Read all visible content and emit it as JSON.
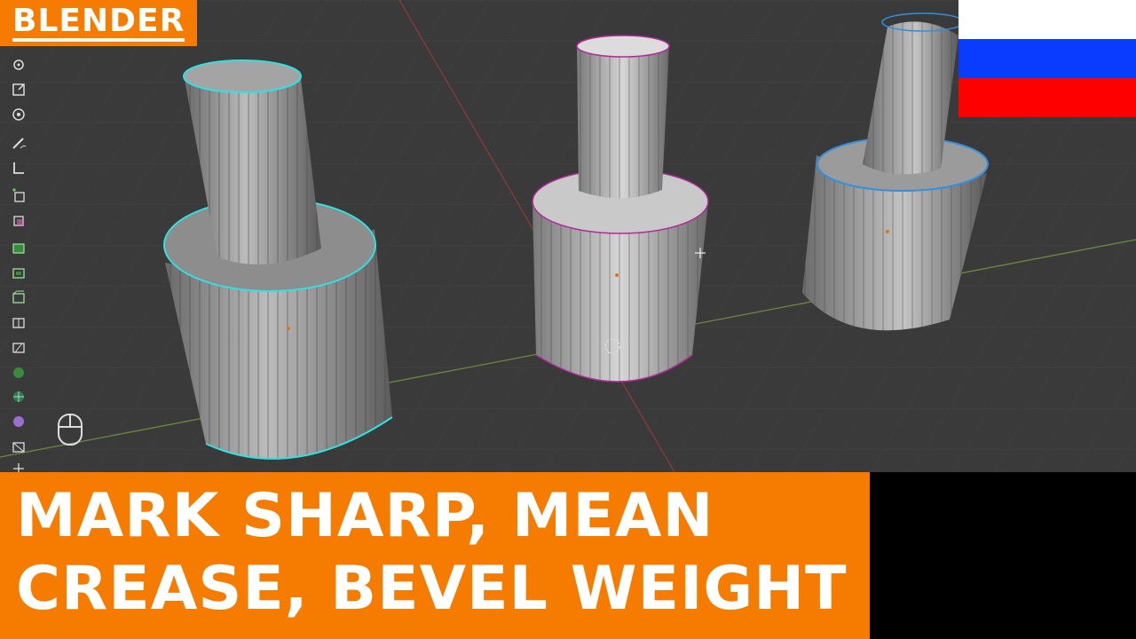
{
  "app": {
    "badge_label": "BLENDER"
  },
  "title": {
    "line1": "MARK SHARP, MEAN",
    "line2": "CREASE, BEVEL WEIGHT"
  },
  "flag": {
    "colors": [
      "#ffffff",
      "#0a3cff",
      "#ff0000"
    ]
  },
  "theme": {
    "accent": "#f57c00",
    "viewport_bg": "#3a3a3a"
  },
  "toolbar": {
    "tools": [
      {
        "name": "transform-icon"
      },
      {
        "name": "scale-icon"
      },
      {
        "name": "rotate-icon"
      },
      {
        "name": "annotate-icon"
      },
      {
        "name": "measure-icon"
      },
      {
        "name": "add-cube-icon"
      },
      {
        "name": "extrude-icon"
      },
      {
        "name": "inset-icon"
      },
      {
        "name": "bevel-icon"
      },
      {
        "name": "loop-cut-icon"
      },
      {
        "name": "knife-icon"
      },
      {
        "name": "poly-build-icon"
      },
      {
        "name": "spin-icon"
      },
      {
        "name": "smooth-icon"
      },
      {
        "name": "shrink-fatten-icon"
      },
      {
        "name": "shear-icon"
      },
      {
        "name": "rip-icon"
      }
    ]
  }
}
